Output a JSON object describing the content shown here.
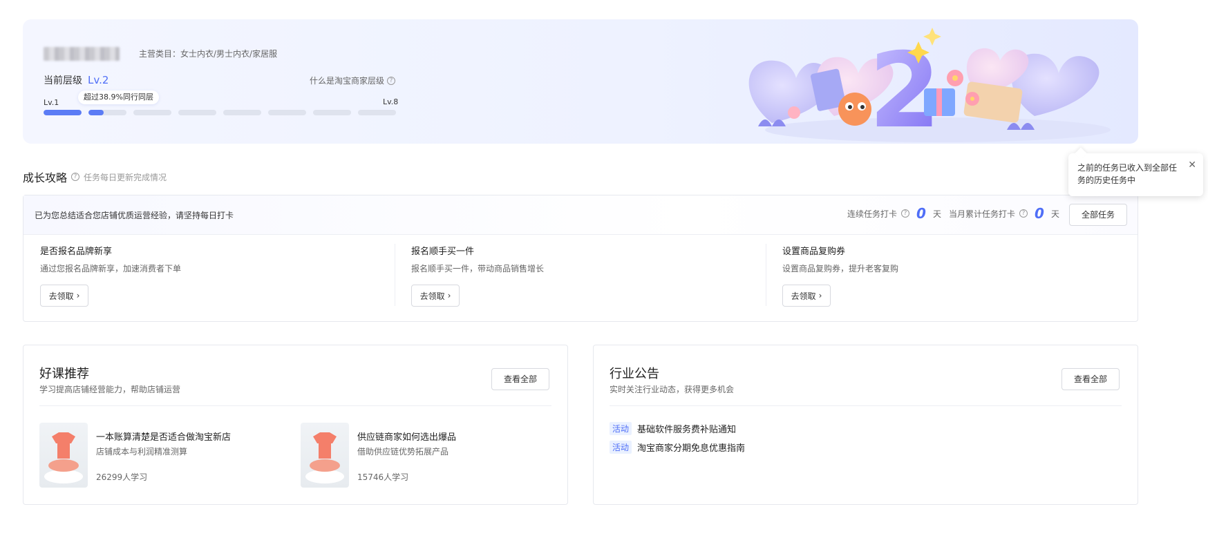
{
  "hero": {
    "category": "主营类目：女士内衣/男士内衣/家居服",
    "level_label": "当前层级",
    "level_value": "Lv.2",
    "what_level": "什么是淘宝商家层级",
    "lv_start": "Lv.1",
    "lv_end": "Lv.8",
    "tip": "超过38.9%同行同层",
    "progress_segments": [
      1.0,
      0.4,
      0,
      0,
      0,
      0,
      0,
      0
    ],
    "illustration_number": "2"
  },
  "growth": {
    "title": "成长攻略",
    "subtitle": "任务每日更新完成情况",
    "intro": "已为您总结适合您店铺优质运营经验，请坚持每日打卡",
    "streak_label": "连续任务打卡",
    "streak_value": "0",
    "streak_unit": "天",
    "month_label": "当月累计任务打卡",
    "month_value": "0",
    "month_unit": "天",
    "all_tasks_button": "全部任务",
    "tasks": [
      {
        "name": "是否报名品牌新享",
        "desc": "通过您报名品牌新享，加速消费者下单",
        "button": "去领取"
      },
      {
        "name": "报名顺手买一件",
        "desc": "报名顺手买一件，带动商品销售增长",
        "button": "去领取"
      },
      {
        "name": "设置商品复购券",
        "desc": "设置商品复购券，提升老客复购",
        "button": "去领取"
      }
    ]
  },
  "popover": {
    "text": "之前的任务已收入到全部任务的历史任务中"
  },
  "courses": {
    "title": "好课推荐",
    "subtitle": "学习提高店铺经营能力，帮助店铺运营",
    "view_all": "查看全部",
    "items": [
      {
        "name": "一本账算清楚是否适合做淘宝新店",
        "desc": "店铺成本与利润精准测算",
        "count": "26299人学习"
      },
      {
        "name": "供应链商家如何选出爆品",
        "desc": "借助供应链优势拓展产品",
        "count": "15746人学习"
      }
    ]
  },
  "notices": {
    "title": "行业公告",
    "subtitle": "实时关注行业动态，获得更多机会",
    "view_all": "查看全部",
    "items": [
      {
        "tag": "活动",
        "text": "基础软件服务费补贴通知"
      },
      {
        "tag": "活动",
        "text": "淘宝商家分期免息优惠指南"
      }
    ]
  },
  "colors": {
    "accent": "#4f6ef7",
    "progress_fill": "#5b7cf5",
    "progress_empty": "#dfe3ee"
  }
}
